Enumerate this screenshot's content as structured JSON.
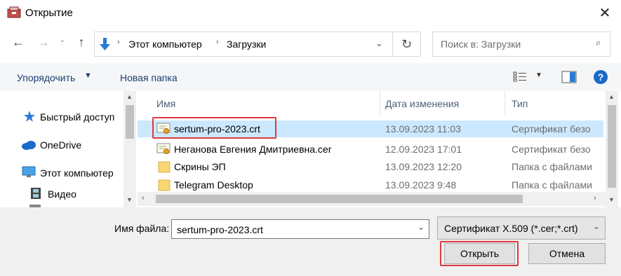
{
  "window": {
    "title": "Открытие"
  },
  "address": {
    "crumbs": [
      "Этот компьютер",
      "Загрузки"
    ]
  },
  "search": {
    "placeholder": "Поиск в: Загрузки"
  },
  "toolbar": {
    "organize": "Упорядочить",
    "new_folder": "Новая папка"
  },
  "sidebar": {
    "items": [
      "Быстрый доступ",
      "OneDrive",
      "Этот компьютер",
      "Видео"
    ]
  },
  "columns": {
    "name": "Имя",
    "date": "Дата изменения",
    "type": "Тип"
  },
  "files": [
    {
      "name": "sertum-pro-2023.crt",
      "date": "13.09.2023 11:03",
      "type": "Сертификат безо",
      "icon": "certificate-icon",
      "selected": true
    },
    {
      "name": "Неганова Евгения Дмитриевна.cer",
      "date": "12.09.2023 17:01",
      "type": "Сертификат безо",
      "icon": "certificate-icon",
      "selected": false
    },
    {
      "name": "Скрины ЭП",
      "date": "13.09.2023 12:20",
      "type": "Папка с файлами",
      "icon": "folder-icon",
      "selected": false
    },
    {
      "name": "Telegram Desktop",
      "date": "13.09.2023 9:48",
      "type": "Папка с файлами",
      "icon": "folder-icon",
      "selected": false
    }
  ],
  "footer": {
    "filename_label": "Имя файла:",
    "filename_value": "sertum-pro-2023.crt",
    "filter": "Сертификат X.509 (*.cer;*.crt)",
    "open": "Открыть",
    "cancel": "Отмена"
  },
  "colors": {
    "highlight": "#e03a3e",
    "selection": "#cce8ff",
    "help": "#1b6ac9",
    "arrow": "#2b7bd3"
  }
}
